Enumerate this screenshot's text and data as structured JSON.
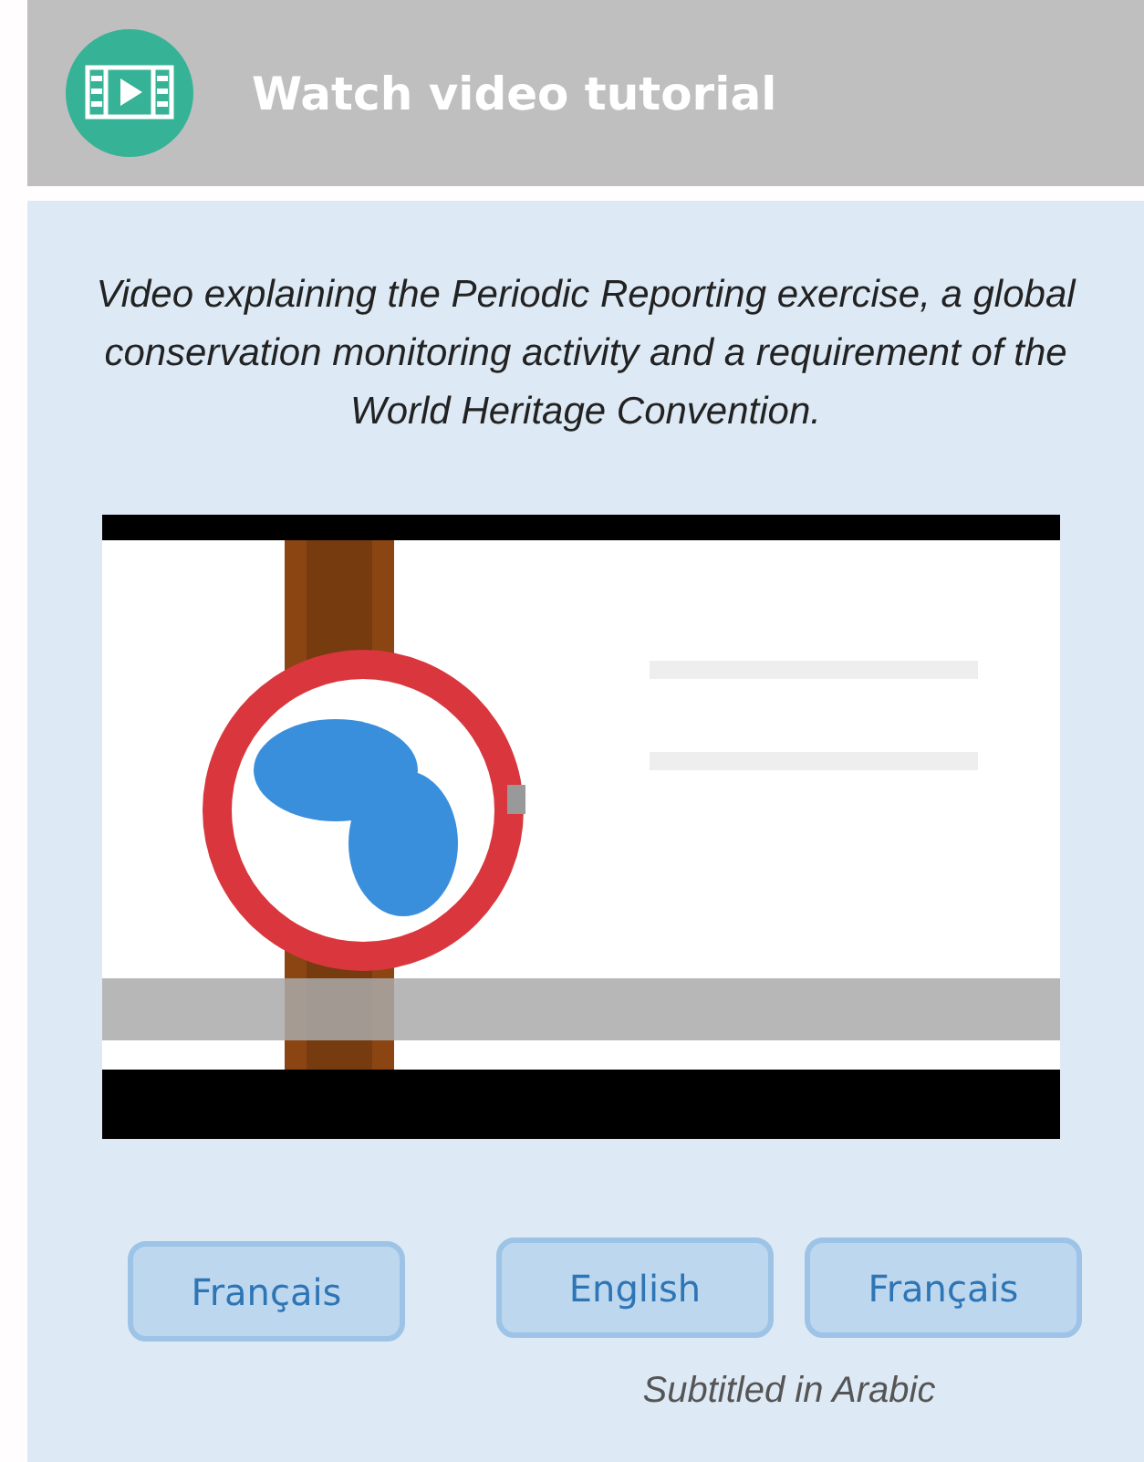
{
  "header": {
    "title": "Watch video tutorial"
  },
  "description": "Video explaining the Periodic Reporting exercise, a global conservation monitoring activity and a requirement of the World Heritage Convention.",
  "language_buttons": [
    {
      "label": "Français"
    }
  ],
  "subtitled": {
    "buttons": [
      {
        "label": "English"
      },
      {
        "label": "Français"
      }
    ],
    "caption": "Subtitled in Arabic"
  }
}
